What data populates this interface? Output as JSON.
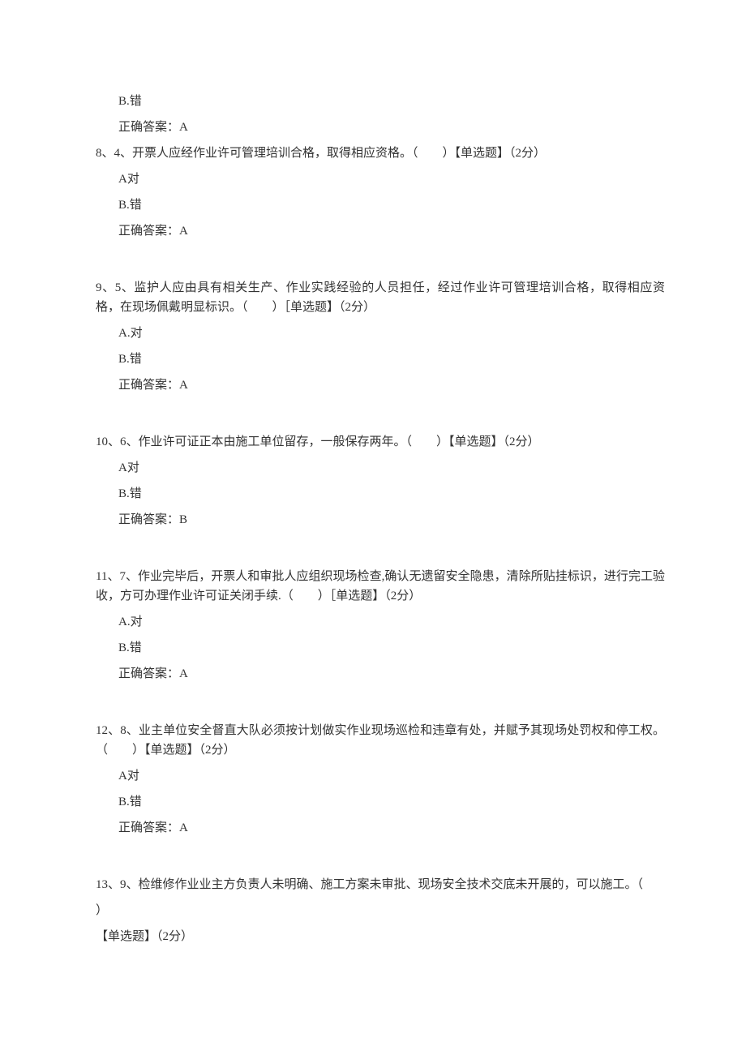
{
  "q7": {
    "optB": "B.错",
    "answer": "正确答案：A"
  },
  "q8": {
    "text": "8、4、开票人应经作业许可管理培训合格，取得相应资格。（　　）【单选题】（2分）",
    "optA": "A对",
    "optB": "B.错",
    "answer": "正确答案：A"
  },
  "q9": {
    "text": "9、5、监护人应由具有相关生产、作业实践经验的人员担任，经过作业许可管理培训合格，取得相应资格，在现场佩戴明显标识。（　　）［单选题】（2分）",
    "optA": "A.对",
    "optB": "B.错",
    "answer": "正确答案：A"
  },
  "q10": {
    "text": "10、6、作业许可证正本由施工单位留存，一般保存两年。（　　）【单选题】（2分）",
    "optA": "A对",
    "optB": "B.错",
    "answer": "正确答案：B"
  },
  "q11": {
    "text": "11、7、作业完毕后，开票人和审批人应组织现场检查,确认无遗留安全隐患，清除所贴挂标识，进行完工验收，方可办理作业许可证关闭手续.（　　）［单选题】（2分）",
    "optA": "A.对",
    "optB": "B.错",
    "answer": "正确答案：A"
  },
  "q12": {
    "text": "12、8、业主单位安全督直大队必须按计划做实作业现场巡检和违章有处，并赋予其现场处罚权和停工权。（　　）【单选题】（2分）",
    "optA": "A对",
    "optB": "B.错",
    "answer": "正确答案：A"
  },
  "q13": {
    "line1": "13、9、检维修作业业主方负责人未明确、施工方案未审批、现场安全技术交底未开展的，可以施工。（",
    "line2": "）",
    "line3": "【单选题】（2分）"
  }
}
